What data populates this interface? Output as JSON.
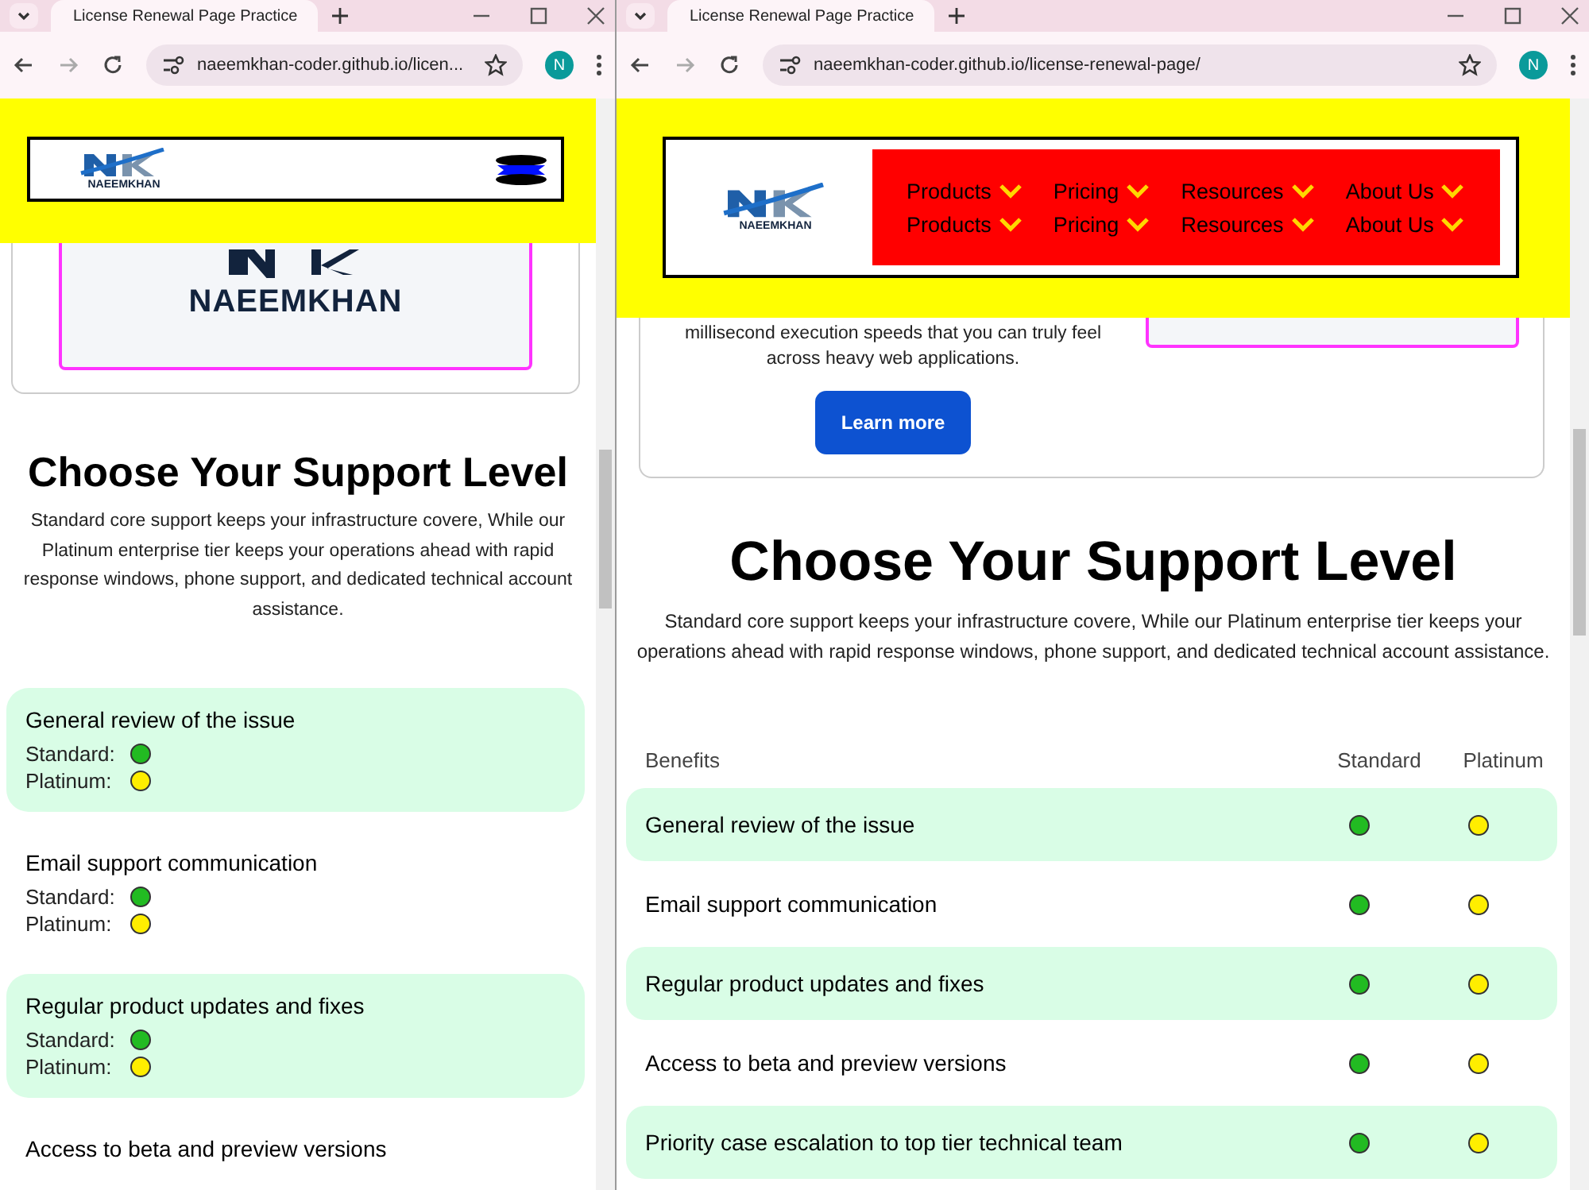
{
  "left": {
    "tab_title": "License Renewal Page Practice",
    "address": "naeemkhan-coder.github.io/licen...",
    "profile": "N",
    "header": {
      "logo_text": "NAEEMKHAN"
    },
    "hero": {
      "logo_text": "NAEEMKHAN"
    },
    "section": {
      "title": "Choose Your Support Level",
      "description": "Standard core support keeps your infrastructure covere, While our Platinum enterprise tier keeps your operations ahead with rapid response windows, phone support, and dedicated technical account assistance."
    },
    "benefits": [
      {
        "name": "General review of the issue",
        "highlighted": true,
        "tiers": [
          {
            "label": "Standard:",
            "color": "#22bb22"
          },
          {
            "label": "Platinum:",
            "color": "#ffee00"
          }
        ]
      },
      {
        "name": "Email support communication",
        "highlighted": false,
        "tiers": [
          {
            "label": "Standard:",
            "color": "#22bb22"
          },
          {
            "label": "Platinum:",
            "color": "#ffee00"
          }
        ]
      },
      {
        "name": "Regular product updates and fixes",
        "highlighted": true,
        "tiers": [
          {
            "label": "Standard:",
            "color": "#22bb22"
          },
          {
            "label": "Platinum:",
            "color": "#ffee00"
          }
        ]
      },
      {
        "name": "Access to beta and preview versions",
        "highlighted": false
      }
    ]
  },
  "right": {
    "tab_title": "License Renewal Page Practice",
    "address": "naeemkhan-coder.github.io/license-renewal-page/",
    "profile": "N",
    "header": {
      "logo_text": "NAEEMKHAN",
      "nav": [
        {
          "label": "Products"
        },
        {
          "label": "Pricing"
        },
        {
          "label": "Resources"
        },
        {
          "label": "About Us"
        },
        {
          "label": "Products"
        },
        {
          "label": "Pricing"
        },
        {
          "label": "Resources"
        },
        {
          "label": "About Us"
        }
      ]
    },
    "hero": {
      "text": "millisecond execution speeds that you can truly feel across heavy web applications.",
      "button": "Learn more"
    },
    "section": {
      "title": "Choose Your Support Level",
      "description": "Standard core support keeps your infrastructure covere, While our Platinum enterprise tier keeps your operations ahead with rapid response windows, phone support, and dedicated technical account assistance."
    },
    "table": {
      "columns": [
        "Benefits",
        "Standard",
        "Platinum"
      ],
      "rows": [
        {
          "name": "General review of the issue",
          "highlighted": true,
          "dots": [
            {
              "color": "#22bb22"
            },
            {
              "color": "#ffee00"
            }
          ]
        },
        {
          "name": "Email support communication",
          "highlighted": false,
          "dots": [
            {
              "color": "#22bb22"
            },
            {
              "color": "#ffee00"
            }
          ]
        },
        {
          "name": "Regular product updates and fixes",
          "highlighted": true,
          "dots": [
            {
              "color": "#22bb22"
            },
            {
              "color": "#ffee00"
            }
          ]
        },
        {
          "name": "Access to beta and preview versions",
          "highlighted": false,
          "dots": [
            {
              "color": "#22bb22"
            },
            {
              "color": "#ffee00"
            }
          ]
        },
        {
          "name": "Priority case escalation to top tier technical team",
          "highlighted": true,
          "dots": [
            {
              "color": "#22bb22"
            },
            {
              "color": "#ffee00"
            }
          ]
        }
      ]
    }
  }
}
